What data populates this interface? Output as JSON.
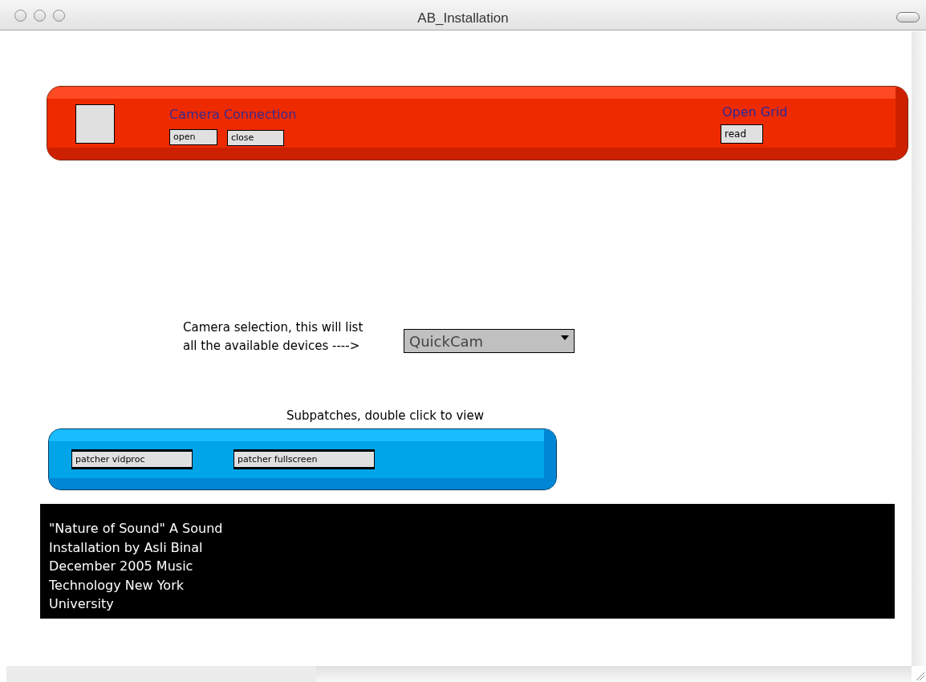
{
  "window": {
    "title": "AB_Installation"
  },
  "camera_panel": {
    "title": "Camera Connection",
    "buttons": [
      "open",
      "close"
    ]
  },
  "grid_panel": {
    "title": "Open Grid",
    "buttons": [
      "read"
    ]
  },
  "camera_selection": {
    "comment": "Camera selection, this will list\nall the available devices ---->",
    "menu_value": "QuickCam"
  },
  "subpatches": {
    "comment": "Subpatches, double click to view",
    "patchers": [
      "patcher vidproc",
      "patcher fullscreen"
    ]
  },
  "credits": "\"Nature of Sound\" A Sound\nInstallation by Asli Binal\nDecember 2005 Music\nTechnology New York\nUniversity"
}
